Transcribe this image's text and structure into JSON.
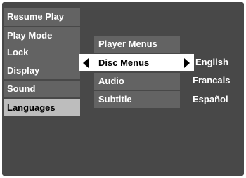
{
  "main_menu": {
    "items": [
      {
        "label": "Resume Play"
      },
      {
        "label": "Play Mode"
      },
      {
        "label": "Lock"
      },
      {
        "label": "Display"
      },
      {
        "label": "Sound"
      },
      {
        "label": "Languages"
      }
    ]
  },
  "languages_menu": {
    "items": [
      {
        "label": "Player Menus"
      },
      {
        "label": "Disc Menus"
      },
      {
        "label": "Audio"
      },
      {
        "label": "Subtitle"
      }
    ]
  },
  "options": [
    {
      "label": "English"
    },
    {
      "label": "Francais"
    },
    {
      "label": "Español"
    }
  ],
  "colors": {
    "background": "#484848",
    "menu_item": "#636363",
    "selected_main": "#bdbdbd",
    "selected_sub": "#ffffff"
  }
}
